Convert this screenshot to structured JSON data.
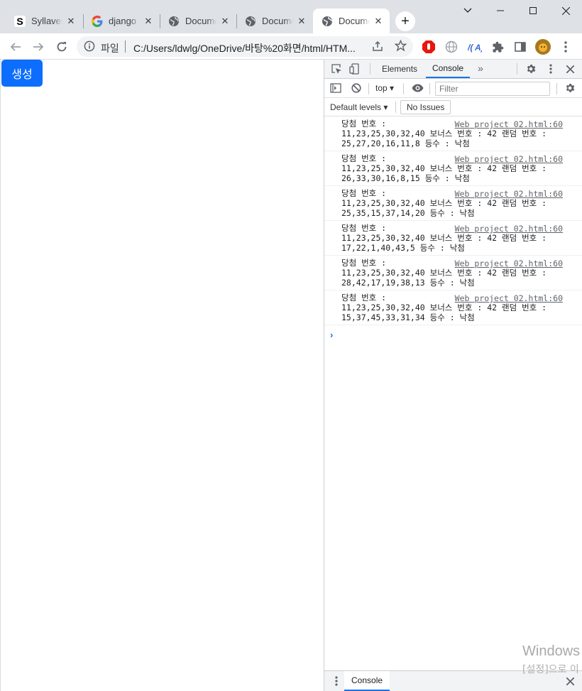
{
  "tabs": [
    {
      "title": "Syllavers",
      "favicon": "s-logo-icon"
    },
    {
      "title": "django",
      "favicon": "google-g-icon"
    },
    {
      "title": "Docume",
      "favicon": "globe-icon"
    },
    {
      "title": "Docume",
      "favicon": "globe-icon"
    },
    {
      "title": "Docume",
      "favicon": "globe-icon",
      "active": true
    }
  ],
  "omnibox": {
    "scheme_label": "파일",
    "url": "C:/Users/ldwlg/OneDrive/바탕%20화면/html/HTM..."
  },
  "page": {
    "generate_button": "생성",
    "button_color": "#0d6efd"
  },
  "devtools": {
    "tabs": {
      "elements": "Elements",
      "console": "Console"
    },
    "context": "top",
    "filter_placeholder": "Filter",
    "levels": "Default levels",
    "issues": "No Issues",
    "drawer_tab": "Console",
    "messages": [
      {
        "line1": "당첨 번호 :",
        "source": "Web project 02.html:60",
        "line2": "11,23,25,30,32,40 보너스 번호 : 42 랜덤 번호 :",
        "line3": "25,27,20,16,11,8 등수 : 낙첨"
      },
      {
        "line1": "당첨 번호 :",
        "source": "Web project 02.html:60",
        "line2": "11,23,25,30,32,40 보너스 번호 : 42 랜덤 번호 :",
        "line3": "26,33,30,16,8,15 등수 : 낙첨"
      },
      {
        "line1": "당첨 번호 :",
        "source": "Web project 02.html:60",
        "line2": "11,23,25,30,32,40 보너스 번호 : 42 랜덤 번호 :",
        "line3": "25,35,15,37,14,20 등수 : 낙첨"
      },
      {
        "line1": "당첨 번호 :",
        "source": "Web project 02.html:60",
        "line2": "11,23,25,30,32,40 보너스 번호 : 42 랜덤 번호 :",
        "line3": "17,22,1,40,43,5 등수 : 낙첨"
      },
      {
        "line1": "당첨 번호 :",
        "source": "Web project 02.html:60",
        "line2": "11,23,25,30,32,40 보너스 번호 : 42 랜덤 번호 :",
        "line3": "28,42,17,19,38,13 등수 : 낙첨"
      },
      {
        "line1": "당첨 번호 :",
        "source": "Web project 02.html:60",
        "line2": "11,23,25,30,32,40 보너스 번호 : 42 랜덤 번호 :",
        "line3": "15,37,45,33,31,34 등수 : 낙첨"
      }
    ]
  },
  "watermark": {
    "line1": "Windows",
    "line2": "[설정]으로 이"
  }
}
